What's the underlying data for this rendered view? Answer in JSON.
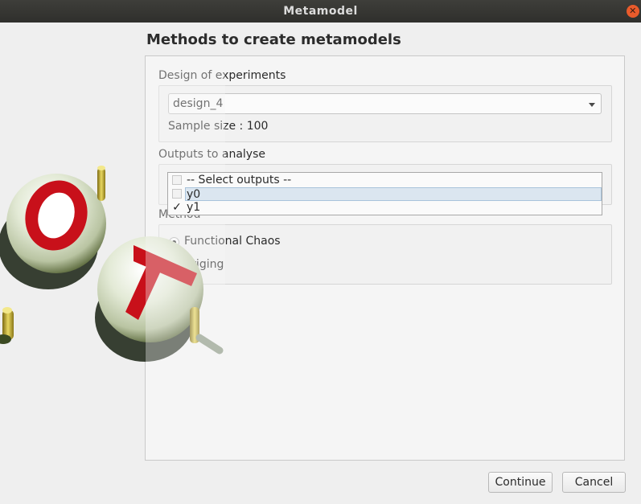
{
  "window": {
    "title": "Metamodel",
    "close_glyph": "✕"
  },
  "page": {
    "title": "Methods to create metamodels"
  },
  "doe": {
    "label": "Design of experiments",
    "selected": "design_4",
    "sample_size_text": "Sample size : 100"
  },
  "outputs": {
    "label": "Outputs to analyse",
    "items": [
      {
        "label": "-- Select outputs --",
        "checked": false
      },
      {
        "label": "y0",
        "checked": false
      },
      {
        "label": "y1",
        "checked": true
      }
    ],
    "check_glyph": "✓"
  },
  "method": {
    "label": "Method",
    "options": [
      {
        "label": "Functional Chaos",
        "selected": true
      },
      {
        "label": "Kriging",
        "selected": false
      }
    ]
  },
  "buttons": {
    "continue": "Continue",
    "cancel": "Cancel"
  },
  "logo": {
    "letters": [
      "O",
      "T"
    ],
    "colors": {
      "sphere": "#eef3e4",
      "letter": "#c8101a",
      "rod": "#c9b230"
    }
  }
}
